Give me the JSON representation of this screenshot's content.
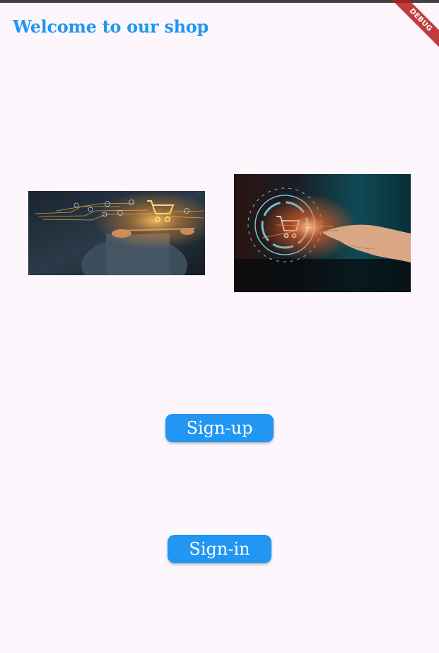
{
  "app": {
    "title": "Welcome to our shop",
    "debug_banner": "DEBUG"
  },
  "images": [
    {
      "name": "shopping-tablet-image"
    },
    {
      "name": "digital-cart-touch-image"
    }
  ],
  "buttons": {
    "signup_label": "Sign-up",
    "signin_label": "Sign-in"
  },
  "colors": {
    "background": "#fdf7fd",
    "accent": "#2196f3",
    "debug": "#b71c1c"
  }
}
